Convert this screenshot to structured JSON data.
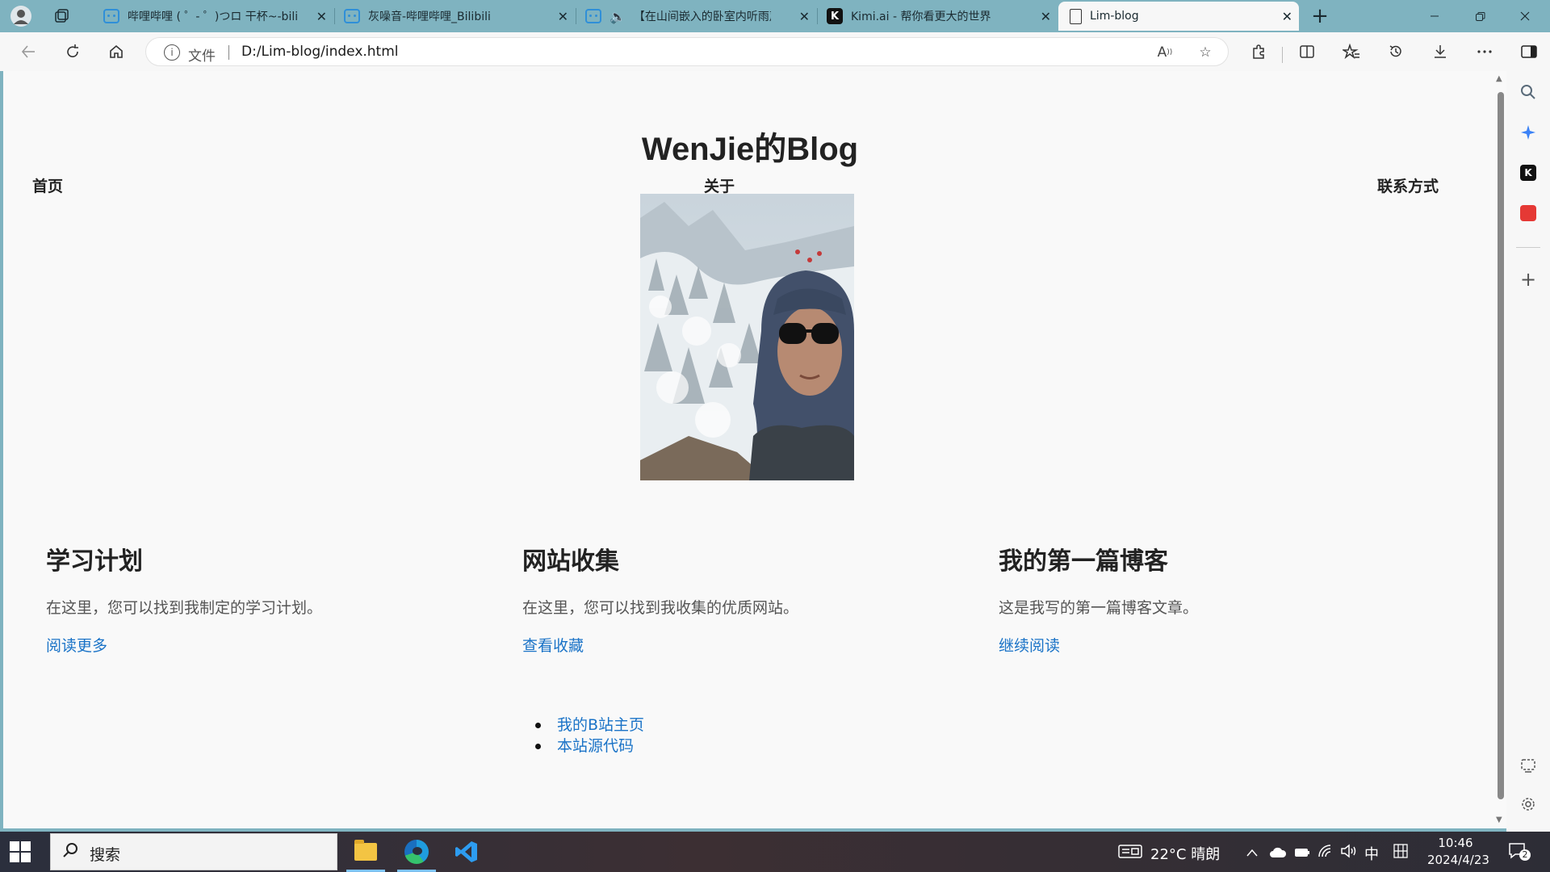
{
  "browser": {
    "tabs": [
      {
        "title": "哔哩哔哩 ( ゜- ゜)つロ 干杯~-bilibili",
        "icon": "bilibili-icon"
      },
      {
        "title": "灰噪音-哔哩哔哩_Bilibili",
        "icon": "bilibili-icon"
      },
      {
        "title": "【在山间嵌入的卧室内听雨声",
        "icon": "bilibili-icon"
      },
      {
        "title": "Kimi.ai - 帮你看更大的世界",
        "icon": "kimi-icon"
      },
      {
        "title": "Lim-blog",
        "icon": "page-icon",
        "active": true
      }
    ],
    "tab_close": "✕",
    "new_tab": "+",
    "address": {
      "scheme_label": "文件",
      "url": "D:/Lim-blog/index.html"
    }
  },
  "page": {
    "site_title": "WenJie的Blog",
    "nav": {
      "home": "首页",
      "about": "关于",
      "contact": "联系方式"
    },
    "cards": [
      {
        "title": "学习计划",
        "text": "在这里，您可以找到我制定的学习计划。",
        "link": "阅读更多"
      },
      {
        "title": "网站收集",
        "text": "在这里，您可以找到我收集的优质网站。",
        "link": "查看收藏"
      },
      {
        "title": "我的第一篇博客",
        "text": "这是我写的第一篇博客文章。",
        "link": "继续阅读"
      }
    ],
    "footer_links": [
      "我的B站主页",
      "本站源代码"
    ]
  },
  "taskbar": {
    "search_placeholder": "搜索",
    "weather": "22°C 晴朗",
    "ime": "中",
    "time": "10:46",
    "date": "2024/4/23",
    "notification_count": "2"
  },
  "colors": {
    "accent_link": "#1a73c7",
    "tab_bar": "#7fb3c0",
    "page_bg": "#f9f9f9"
  }
}
